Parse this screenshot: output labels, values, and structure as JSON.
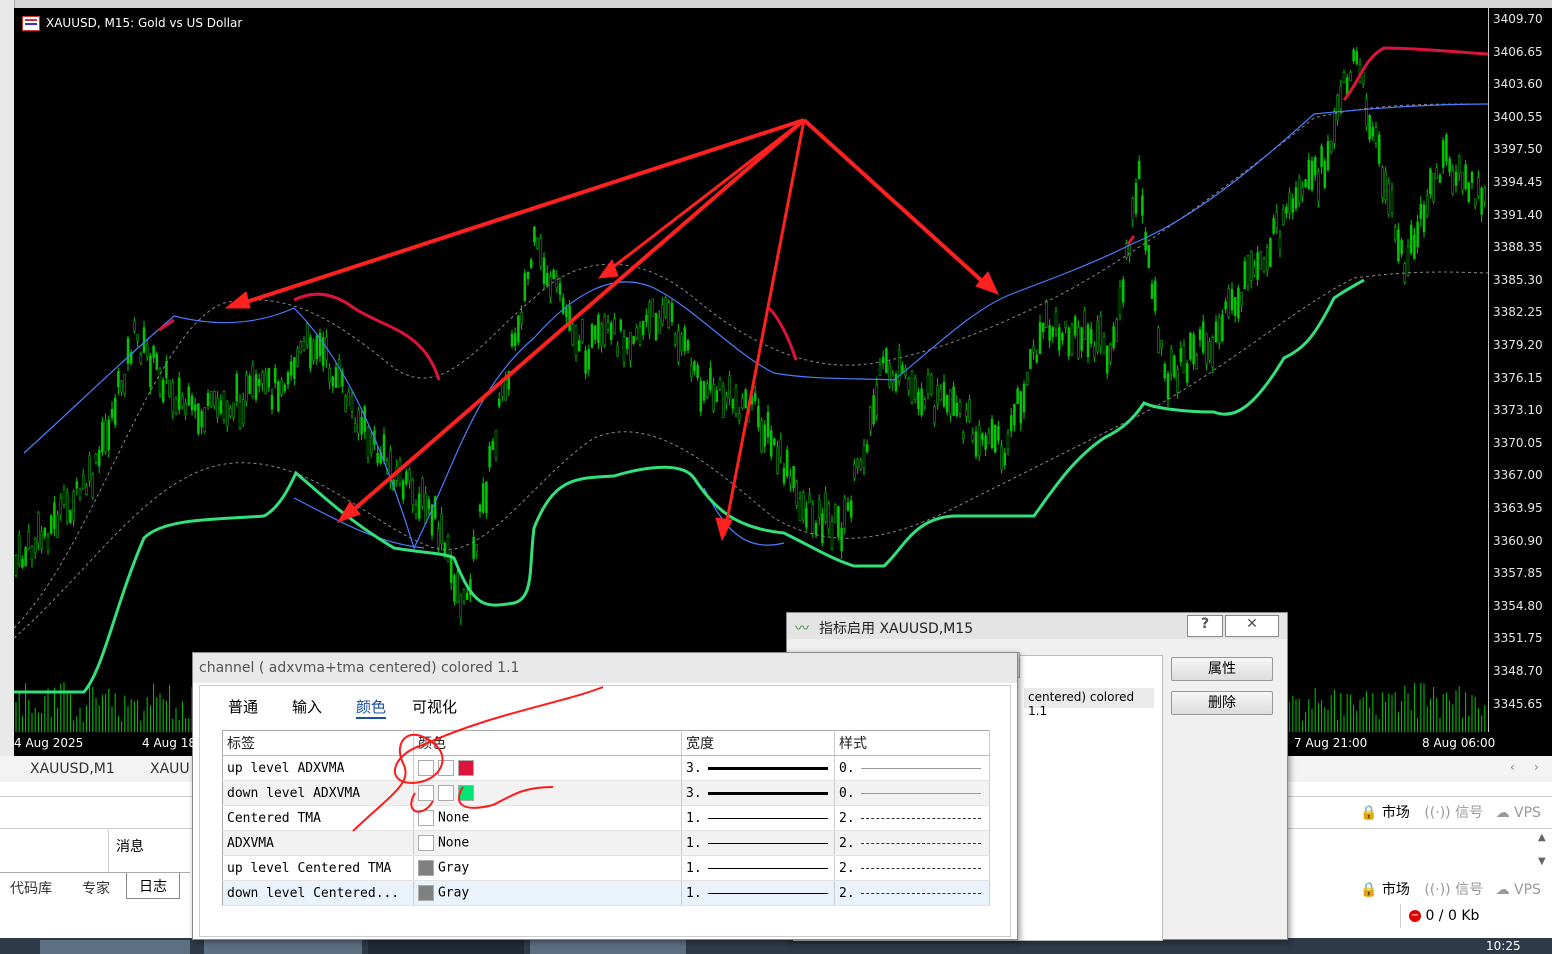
{
  "chart_window": {
    "title": "XAUUSD, M15:  Gold vs US Dollar",
    "price_labels": [
      "3409.70",
      "3406.65",
      "3403.60",
      "3400.55",
      "3397.50",
      "3394.45",
      "3391.40",
      "3388.35",
      "3385.30",
      "3382.25",
      "3379.20",
      "3376.15",
      "3373.10",
      "3370.05",
      "3367.00",
      "3363.95",
      "3360.90",
      "3357.85",
      "3354.80",
      "3351.75",
      "3348.70",
      "3345.65"
    ],
    "time_labels": [
      "4 Aug 2025",
      "4 Aug 18",
      "7 Aug 21:00",
      "8 Aug 06:00"
    ]
  },
  "symbol_tabs": [
    "XAUUSD,M1",
    "XAUU"
  ],
  "terminal": {
    "message_header": "消息",
    "tabs": [
      "代码库",
      "专家",
      "日志"
    ]
  },
  "status": {
    "market": "市场",
    "signal": "信号",
    "vps": "VPS",
    "traffic": "0 / 0 Kb"
  },
  "taskbar": {
    "time": "10:25"
  },
  "indicators_dialog": {
    "title": "指标启用 XAUUSD,M15",
    "help": "?",
    "close": "✕",
    "list_item": "centered) colored 1.1",
    "properties_button": "属性",
    "delete_button": "删除"
  },
  "props_dialog": {
    "title": "channel ( adxvma+tma centered) colored 1.1",
    "tabs": [
      "普通",
      "输入",
      "颜色",
      "可视化"
    ],
    "active_tab": "颜色",
    "columns": [
      "标签",
      "颜色",
      "宽度",
      "样式"
    ],
    "rows": [
      {
        "label": "up level ADXVMA",
        "color_text": "",
        "swatch": "#dc143c",
        "width": "3.",
        "style": "0."
      },
      {
        "label": "down level ADXVMA",
        "color_text": "",
        "swatch": "#00e676",
        "width": "3.",
        "style": "0."
      },
      {
        "label": "Centered TMA",
        "color_text": "None",
        "swatch": "#ffffff",
        "width": "1.",
        "style": "2."
      },
      {
        "label": "ADXVMA",
        "color_text": "None",
        "swatch": "#ffffff",
        "width": "1.",
        "style": "2."
      },
      {
        "label": "up level Centered TMA",
        "color_text": "Gray",
        "swatch": "#808080",
        "width": "1.",
        "style": "2."
      },
      {
        "label": "down level Centered...",
        "color_text": "Gray",
        "swatch": "#808080",
        "width": "1.",
        "style": "2."
      }
    ]
  },
  "colors": {
    "candles": "#00c800",
    "adxvma": "#3a6cff",
    "up_level": "#dc143c",
    "down_level": "#33e07a",
    "annotation": "#ff2020"
  }
}
